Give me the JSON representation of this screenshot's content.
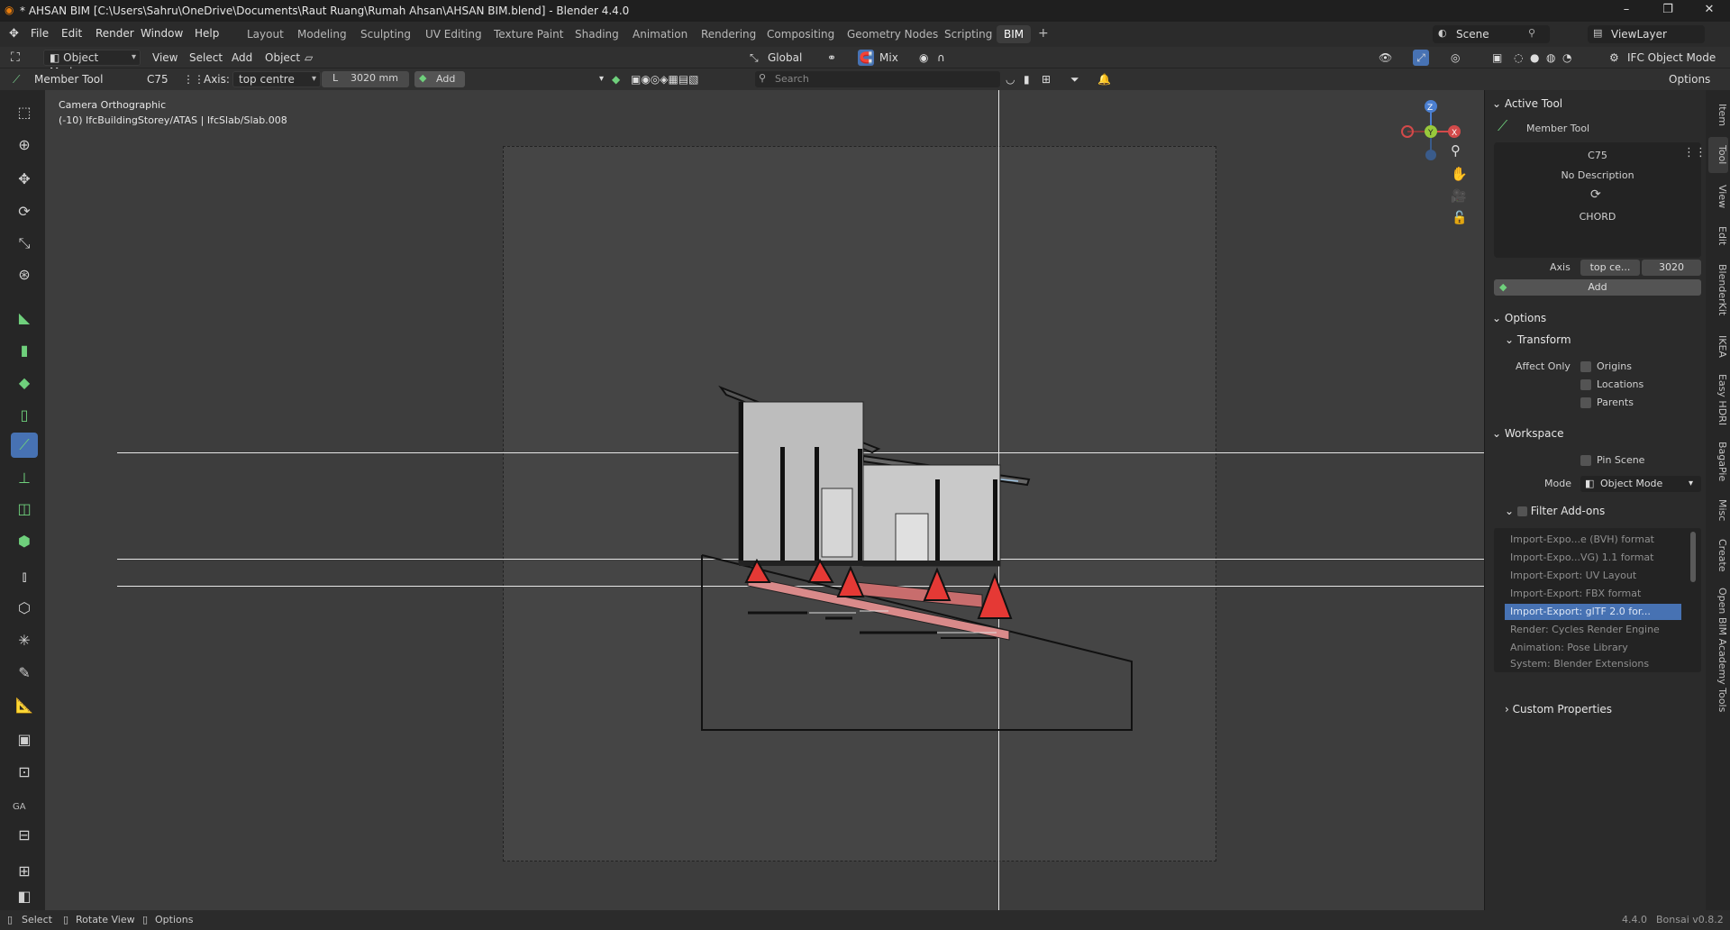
{
  "window": {
    "title": "* AHSAN BIM [C:\\Users\\Sahru\\OneDrive\\Documents\\Raut Ruang\\Rumah Ahsan\\AHSAN BIM.blend] - Blender 4.4.0"
  },
  "menu": [
    "File",
    "Edit",
    "Render",
    "Window",
    "Help"
  ],
  "workspaces": [
    "Layout",
    "Modeling",
    "Sculpting",
    "UV Editing",
    "Texture Paint",
    "Shading",
    "Animation",
    "Rendering",
    "Compositing",
    "Geometry Nodes",
    "Scripting",
    "BIM"
  ],
  "active_workspace": "BIM",
  "scene": "Scene",
  "view_layer": "ViewLayer",
  "header": {
    "mode": "Object Mode",
    "menus": [
      "View",
      "Select",
      "Add",
      "Object"
    ],
    "orientation": "Global",
    "snap": "Mix",
    "ifc_mode": "IFC Object Mode",
    "options": "Options"
  },
  "toolsettings": {
    "tool": "Member Tool",
    "type": "C75",
    "axis_label": "Axis:",
    "axis": "top centre",
    "length_prefix": "L",
    "length": "3020 mm",
    "add": "Add",
    "search_placeholder": "Search"
  },
  "viewport": {
    "camera": "Camera Orthographic",
    "context": "(-10) IfcBuildingStorey/ATAS | IfcSlab/Slab.008"
  },
  "gizmo": {
    "z": "Z",
    "y": "Y",
    "x": "X"
  },
  "sidebar": {
    "active_tool_header": "Active Tool",
    "active_tool_name": "Member Tool",
    "type_name": "C75",
    "description": "No Description",
    "profile": "CHORD",
    "axis_label": "Axis",
    "axis_value": "top ce...",
    "length_value": "3020",
    "add": "Add",
    "options_header": "Options",
    "transform_header": "Transform",
    "affect_only": "Affect Only",
    "origins": "Origins",
    "locations": "Locations",
    "parents": "Parents",
    "workspace_header": "Workspace",
    "pin_scene": "Pin Scene",
    "mode_label": "Mode",
    "mode_value": "Object Mode",
    "filter_addons": "Filter Add-ons",
    "addons": [
      "Import-Expo...e (BVH) format",
      "Import-Expo...VG) 1.1 format",
      "Import-Export: UV Layout",
      "Import-Export: FBX format",
      "Import-Export: glTF 2.0 for...",
      "Render: Cycles Render Engine",
      "Animation: Pose Library",
      "System: Blender Extensions"
    ],
    "selected_addon_index": 4,
    "custom_properties": "Custom Properties"
  },
  "side_tabs": [
    "Item",
    "Tool",
    "View",
    "Edit",
    "BlenderKit",
    "IKEA",
    "Easy HDRI",
    "BagaPie",
    "Misc",
    "Create",
    "Open BIM Academy Tools"
  ],
  "active_side_tab": "Tool",
  "toolbar_group_label": "GA",
  "status": {
    "select": "Select",
    "rotate": "Rotate View",
    "options": "Options",
    "version": "4.4.0",
    "addon_version": "Bonsai v0.8.2"
  }
}
